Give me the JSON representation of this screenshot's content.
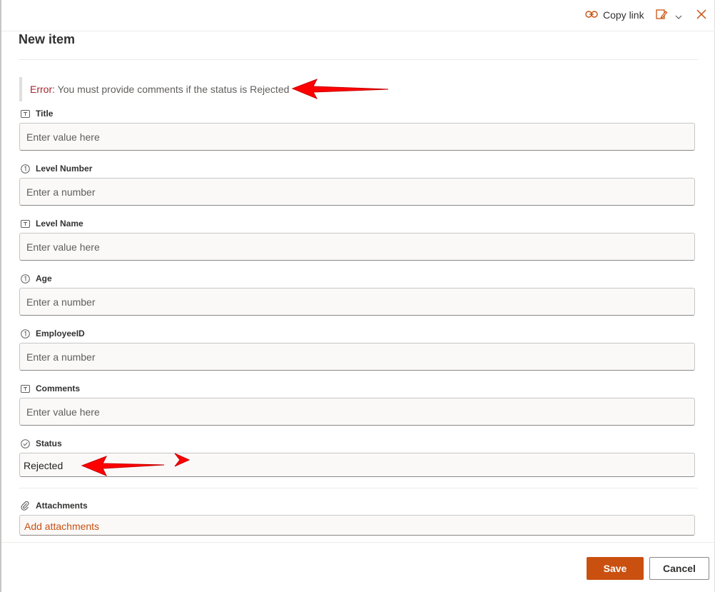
{
  "toolbar": {
    "copy_link_label": "Copy link",
    "copy_link_icon": "link-icon",
    "edit_icon": "edit-form-icon",
    "close_icon": "close-icon",
    "accent": "#ca5010"
  },
  "panel": {
    "title": "New item"
  },
  "error": {
    "prefix": "Error:",
    "message": "You must provide comments if the status is Rejected",
    "color": "#a4262c"
  },
  "fields": [
    {
      "label": "Title",
      "icon": "text-field-icon",
      "placeholder": "Enter value here",
      "value": ""
    },
    {
      "label": "Level Number",
      "icon": "number-field-icon",
      "placeholder": "Enter a number",
      "value": ""
    },
    {
      "label": "Level Name",
      "icon": "text-field-icon",
      "placeholder": "Enter value here",
      "value": ""
    },
    {
      "label": "Age",
      "icon": "number-field-icon",
      "placeholder": "Enter a number",
      "value": ""
    },
    {
      "label": "EmployeeID",
      "icon": "number-field-icon",
      "placeholder": "Enter a number",
      "value": ""
    },
    {
      "label": "Comments",
      "icon": "text-field-icon",
      "placeholder": "Enter value here",
      "value": ""
    },
    {
      "label": "Status",
      "icon": "choice-field-icon",
      "placeholder": "",
      "value": "Rejected"
    }
  ],
  "attachments": {
    "label": "Attachments",
    "icon": "paperclip-icon",
    "add_label": "Add attachments"
  },
  "footer": {
    "save_label": "Save",
    "cancel_label": "Cancel",
    "save_color": "#ca5010"
  },
  "annotations": {
    "arrow_color": "#ff0000"
  }
}
